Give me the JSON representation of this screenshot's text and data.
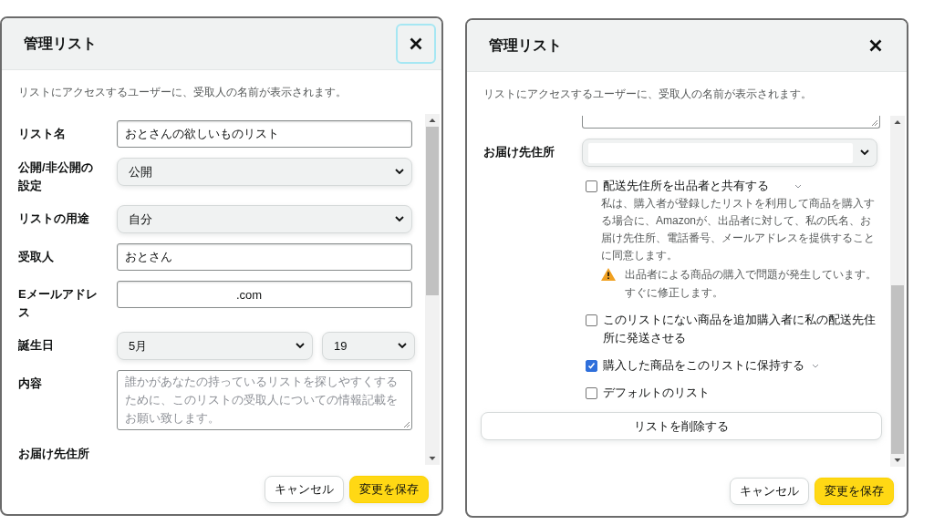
{
  "dialogs": [
    {
      "title": "管理リスト",
      "close_focused": true,
      "notice": "リストにアクセスするユーザーに、受取人の名前が表示されます。",
      "fields": [
        {
          "kind": "text",
          "label": "リスト名",
          "value": "おとさんの欲しいものリスト"
        },
        {
          "kind": "select",
          "label": "公開/非公開の設定",
          "value": "公開"
        },
        {
          "kind": "select",
          "label": "リストの用途",
          "value": "自分"
        },
        {
          "kind": "text",
          "label": "受取人",
          "value": "おとさん"
        },
        {
          "kind": "email",
          "label": "Eメールアドレス",
          "value": ".com"
        },
        {
          "kind": "select_pair",
          "label": "誕生日",
          "values": [
            "5月",
            "19"
          ]
        },
        {
          "kind": "textarea",
          "label": "内容",
          "placeholder": "誰かがあなたの持っているリストを探しやすくするために、このリストの受取人についての情報記載をお願い致します。"
        },
        {
          "kind": "label",
          "label": "お届け先住所"
        }
      ],
      "buttons": [
        {
          "label": "キャンセル",
          "primary": false
        },
        {
          "label": "変更を保存",
          "primary": true
        }
      ]
    },
    {
      "title": "管理リスト",
      "close_focused": false,
      "notice": "リストにアクセスするユーザーに、受取人の名前が表示されます。",
      "fields": [
        {
          "kind": "textarea_edge"
        },
        {
          "kind": "select",
          "label": "お届け先住所"
        }
      ],
      "options": [
        {
          "label": "配送先住所を出品者と共有する",
          "checked": false,
          "expandable": true,
          "description": "私は、購入者が登録したリストを利用して商品を購入する場合に、Amazonが、出品者に対して、私の氏名、お届け先住所、電話番号、メールアドレスを提供することに同意します。",
          "warning": "出品者による商品の購入で問題が発生しています。すぐに修正します。"
        },
        {
          "label": "このリストにない商品を追加購入者に私の配送先住所に発送させる",
          "checked": false,
          "expandable": false
        },
        {
          "label": "購入した商品をこのリストに保持する",
          "checked": true,
          "expandable": true
        },
        {
          "label": "デフォルトのリスト",
          "checked": false,
          "expandable": false
        }
      ],
      "delete_button": "リストを削除する",
      "buttons": [
        {
          "label": "キャンセル",
          "primary": false
        },
        {
          "label": "変更を保存",
          "primary": true
        }
      ]
    }
  ]
}
